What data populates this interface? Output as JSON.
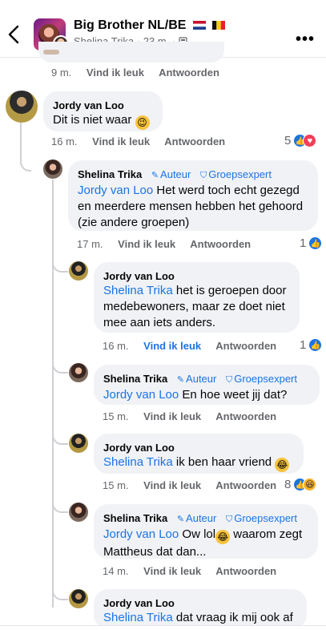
{
  "header": {
    "title": "Big Brother NL/BE",
    "author": "Shelina Trika",
    "time": "23 m.",
    "more_label": "•••"
  },
  "actions": {
    "reply": "Antwoorden",
    "like": "Vind ik leuk"
  },
  "tags": {
    "author": "Auteur",
    "expert": "Groepsexpert"
  },
  "top_meta": {
    "time": "9 m."
  },
  "c1": {
    "author": "Jordy van Loo",
    "text": "Dit is niet waar",
    "time": "16 m.",
    "reactions": "5"
  },
  "c2": {
    "author": "Shelina Trika",
    "mention": "Jordy van Loo",
    "text": " Het werd toch echt gezegd en meerdere mensen hebben het gehoord (zie andere groepen)",
    "time": "17 m.",
    "reactions": "1"
  },
  "c3": {
    "author": "Jordy van Loo",
    "mention": "Shelina Trika",
    "text": " het is geroepen door medebewoners, maar ze doet niet mee aan iets anders.",
    "time": "16 m.",
    "reactions": "1"
  },
  "c4": {
    "author": "Shelina Trika",
    "mention": "Jordy van Loo",
    "text": " En hoe weet jij dat?",
    "time": "15 m."
  },
  "c5": {
    "author": "Jordy van Loo",
    "mention": "Shelina Trika",
    "text": " ik ben haar vriend",
    "time": "15 m.",
    "reactions": "8"
  },
  "c6": {
    "author": "Shelina Trika",
    "mention": "Jordy van Loo",
    "text_a": " Ow lol",
    "text_b": " waarom zegt Mattheus dat dan...",
    "time": "14 m."
  },
  "c7": {
    "author": "Jordy van Loo",
    "mention": "Shelina Trika",
    "text": " dat vraag ik mij ook af"
  },
  "colors": {
    "accent": "#1b74e4",
    "bubble": "#f0f2f5",
    "heart": "#f33e58"
  },
  "icons": [
    "back-icon",
    "more-icon",
    "globe-icon",
    "like-icon",
    "heart-icon",
    "haha-icon",
    "wink-emoji",
    "laugh-emoji",
    "pen-icon",
    "shield-icon"
  ]
}
